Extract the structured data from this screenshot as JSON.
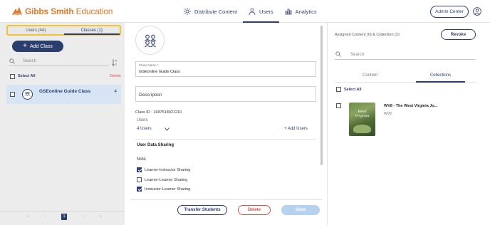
{
  "header": {
    "logo_text_bold": "Gibbs Smith",
    "logo_text_light": " Education",
    "nav": [
      {
        "label": "Distribute Content",
        "icon": "sun-icon"
      },
      {
        "label": "Users",
        "icon": "user-icon",
        "active": true
      },
      {
        "label": "Analytics",
        "icon": "bar-chart-icon"
      }
    ],
    "admin_button": "Admin Center",
    "account_icon": "account-circle-icon"
  },
  "left_panel": {
    "tabs": [
      {
        "label": "Users (44)"
      },
      {
        "label": "Classes (1)",
        "active": true
      }
    ],
    "add_class_label": "Add Class",
    "search_placeholder": "Search",
    "select_all_label": "Select All",
    "delete_label": "Delete",
    "classes": [
      {
        "name": "GSEonline Guide Class",
        "count": "4"
      }
    ],
    "pagination": {
      "first": "«",
      "prev": "‹",
      "current": "1",
      "next": "›",
      "last": "»"
    }
  },
  "middle_panel": {
    "class_name_label": "Class Name *",
    "class_name_value": "GSEonline Guide Class",
    "description_placeholder": "Description",
    "class_id": "Class ID : 1687518921210",
    "users_label": "Users",
    "users_count": "4 Users",
    "add_users_label": "+ Add Users",
    "data_sharing_title": "User Data Sharing",
    "note_label": "Note",
    "sharing_options": [
      {
        "label": "Learner-Instructor Sharing",
        "checked": true
      },
      {
        "label": "Learner-Learner Sharing",
        "checked": false
      },
      {
        "label": "Instructor-Learner Sharing",
        "checked": true
      }
    ],
    "transfer_button": "Transfer Students",
    "delete_button": "Delete",
    "save_button": "Save"
  },
  "right_panel": {
    "assigned_text": "Assigned Content (0) & Collection (2)",
    "revoke_button": "Revoke",
    "search_placeholder": "Search",
    "tabs": [
      {
        "label": "Content"
      },
      {
        "label": "Collections",
        "active": true
      }
    ],
    "select_all_label": "Select All",
    "collections": [
      {
        "title": "WV8 - The West Virginia Jo...",
        "subtitle": "WV8",
        "thumb_line1": "West",
        "thumb_line2": "Virginia"
      }
    ]
  },
  "colors": {
    "brand_orange": "#e07a2c",
    "primary_navy": "#2c3e6e",
    "highlight_yellow": "#f2c230",
    "danger_red": "#d9534f",
    "selected_row": "#d6e4f3",
    "disabled_save": "#b6d2ee"
  }
}
